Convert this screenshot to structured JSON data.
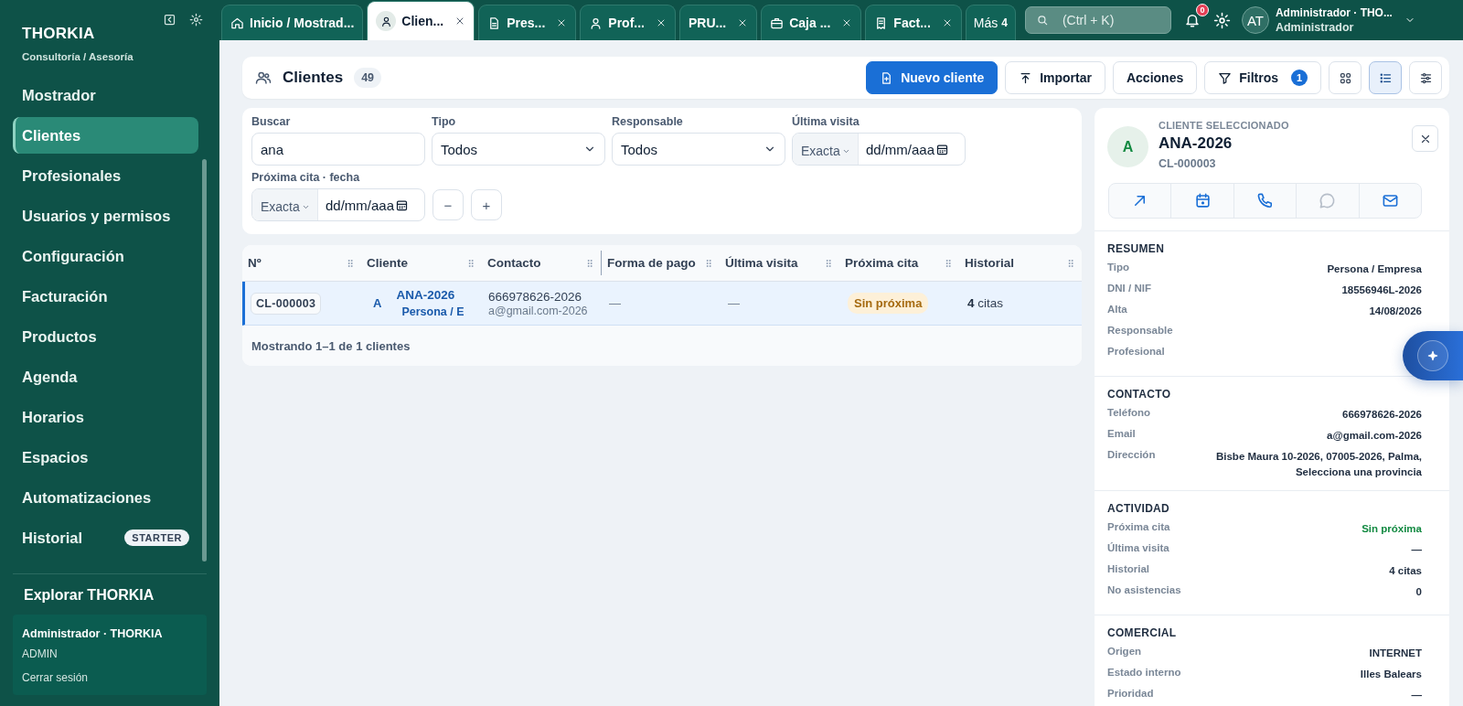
{
  "sidebar": {
    "brand": "THORKIA",
    "subtitle": "Consultoría / Asesoría",
    "items": [
      {
        "label": "Mostrador",
        "selected": false
      },
      {
        "label": "Clientes",
        "selected": true
      },
      {
        "label": "Profesionales",
        "selected": false
      },
      {
        "label": "Usuarios y permisos",
        "selected": false
      },
      {
        "label": "Configuración",
        "selected": false
      },
      {
        "label": "Facturación",
        "selected": false
      },
      {
        "label": "Productos",
        "selected": false
      },
      {
        "label": "Agenda",
        "selected": false
      },
      {
        "label": "Horarios",
        "selected": false
      },
      {
        "label": "Espacios",
        "selected": false
      },
      {
        "label": "Automatizaciones",
        "selected": false
      },
      {
        "label": "Historial",
        "selected": false,
        "badge": "STARTER"
      }
    ],
    "explore": "Explorar THORKIA",
    "user": {
      "name": "Administrador · THORKIA",
      "role": "ADMIN",
      "logout": "Cerrar sesión"
    }
  },
  "tabs": [
    {
      "label": "Inicio / Mostrad...",
      "kind": "home",
      "selected": false,
      "closable": false
    },
    {
      "label": "Clien...",
      "kind": "person",
      "selected": true,
      "closable": true
    },
    {
      "label": "Pres...",
      "kind": "document",
      "selected": false,
      "closable": true
    },
    {
      "label": "Prof...",
      "kind": "person",
      "selected": false,
      "closable": true
    },
    {
      "label": "PRU...",
      "kind": "plain",
      "selected": false,
      "closable": true
    },
    {
      "label": "Caja ...",
      "kind": "briefcase",
      "selected": false,
      "closable": true
    },
    {
      "label": "Fact...",
      "kind": "receipt",
      "selected": false,
      "closable": true
    }
  ],
  "more_tabs": {
    "label": "Más",
    "count": "4"
  },
  "search": {
    "placeholder": "(Ctrl + K)"
  },
  "notifications": {
    "count": "0"
  },
  "account": {
    "initials": "AT",
    "name": "Administrador · THO...",
    "role": "Administrador"
  },
  "header": {
    "title": "Clientes",
    "count": "49",
    "buttons": [
      {
        "label": "Nuevo cliente",
        "kind": "primary"
      },
      {
        "label": "Importar",
        "kind": "import"
      },
      {
        "label": "Acciones",
        "kind": "plain"
      },
      {
        "label": "Filtros",
        "kind": "filter",
        "badge": "1"
      }
    ],
    "views": [
      {
        "kind": "grid",
        "selected": false
      },
      {
        "kind": "list",
        "selected": true
      },
      {
        "kind": "settings",
        "selected": false
      }
    ]
  },
  "filters": [
    {
      "label": "Buscar",
      "kind": "text",
      "value": "ana"
    },
    {
      "label": "Tipo",
      "kind": "select",
      "value": "Todos"
    },
    {
      "label": "Responsable",
      "kind": "select",
      "value": "Todos"
    },
    {
      "label": "Última visita",
      "kind": "date",
      "mode": "Exacta",
      "placeholder": "dd/mm/aaa"
    },
    {
      "label": "Próxima cita · fecha",
      "kind": "date",
      "mode": "Exacta",
      "placeholder": "dd/mm/aaa"
    }
  ],
  "filter_buttons": [
    "−",
    "+"
  ],
  "table": {
    "columns": [
      "Nº",
      "Cliente",
      "Contacto",
      "Forma de pago",
      "Última visita",
      "Próxima cita",
      "Historial"
    ],
    "rows": [
      {
        "selected": true,
        "number": "CL-000003",
        "initial": "A",
        "name": "ANA-2026",
        "type": "Persona / E",
        "phone": "666978626-2026",
        "email": "a@gmail.com-2026",
        "payment": "—",
        "last_visit": "—",
        "next": "Sin próxima",
        "history": "**4** citas"
      }
    ],
    "footer": "Mostrando 1–1 de 1 clientes"
  },
  "detail": {
    "eyebrow": "CLIENTE SELECCIONADO",
    "initial": "A",
    "name": "ANA-2026",
    "code": "CL-000003",
    "actions": [
      {
        "kind": "open",
        "disabled": false
      },
      {
        "kind": "calendar",
        "disabled": false
      },
      {
        "kind": "phone",
        "disabled": false
      },
      {
        "kind": "chat",
        "disabled": true
      },
      {
        "kind": "mail",
        "disabled": false
      }
    ],
    "sections": [
      {
        "title": "RESUMEN",
        "rows": [
          {
            "label": "Tipo",
            "value": "Persona / Empresa"
          },
          {
            "label": "DNI / NIF",
            "value": "18556946L-2026"
          },
          {
            "label": "Alta",
            "value": "14/08/2026"
          },
          {
            "label": "Responsable"
          },
          {
            "label": "Profesional"
          }
        ]
      },
      {
        "title": "CONTACTO",
        "rows": [
          {
            "label": "Teléfono",
            "value": "666978626-2026"
          },
          {
            "label": "Email",
            "value": "a@gmail.com-2026"
          },
          {
            "label": "Dirección",
            "value": "Bisbe Maura 10-2026, 07005-2026, Palma, Selecciona una provincia"
          }
        ]
      },
      {
        "title": "ACTIVIDAD",
        "rows": [
          {
            "label": "Próxima cita",
            "value": "Sin próxima",
            "positive": true
          },
          {
            "label": "Última visita",
            "value": "—"
          },
          {
            "label": "Historial",
            "value": "4 citas"
          },
          {
            "label": "No asistencias",
            "value": "0"
          }
        ]
      },
      {
        "title": "COMERCIAL",
        "rows": [
          {
            "label": "Origen",
            "value": "INTERNET"
          },
          {
            "label": "Estado interno",
            "value": "Illes Balears"
          },
          {
            "label": "Prioridad",
            "value": "—"
          }
        ]
      }
    ]
  }
}
